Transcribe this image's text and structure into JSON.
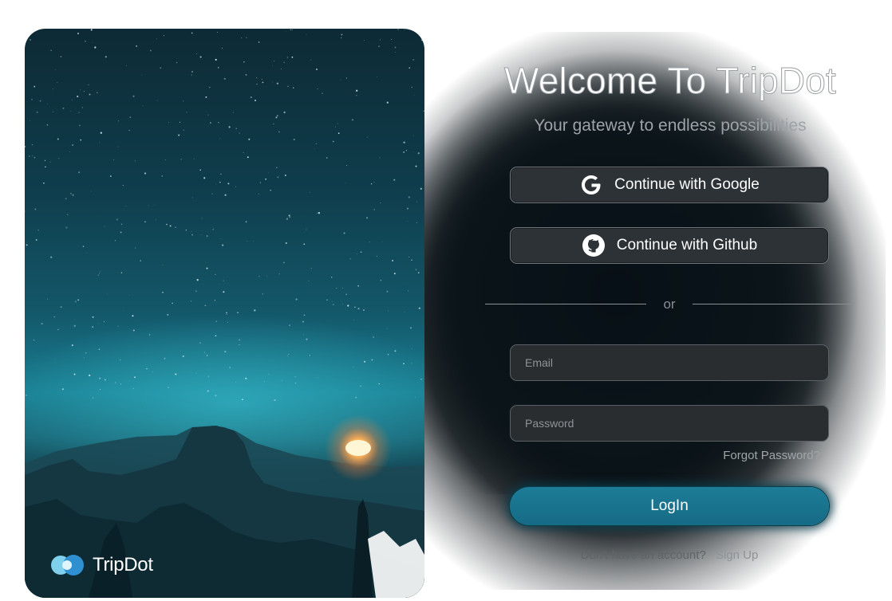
{
  "login_card": {
    "title": "Welcome To TripDot",
    "subtitle": "Your gateway to endless possibilities",
    "google_button_label": "Continue with Google",
    "github_button_label": "Continue with Github",
    "divider_text": "or",
    "email_placeholder": "Email",
    "password_placeholder": "Password",
    "forgot_password_label": "Forgot Password?",
    "login_button_label": "LogIn",
    "no_account_text": "Don't have an account?",
    "signup_link_label": "Sign Up"
  },
  "brand": {
    "name": "TripDot",
    "logo_icon": "tripdot-logo-icon"
  },
  "hero": {
    "image": "night-sky-mountain-photo"
  },
  "colors": {
    "accent": "#1d7c97",
    "button_bg": "#2d3236",
    "field_bg": "#2a2d30"
  }
}
